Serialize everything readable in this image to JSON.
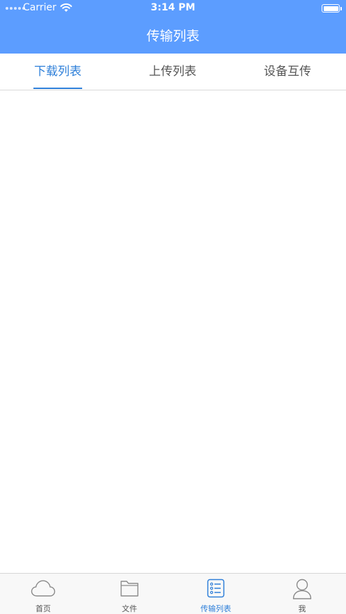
{
  "status_bar": {
    "carrier": "Carrier",
    "time": "3:14 PM"
  },
  "nav": {
    "title": "传输列表"
  },
  "tabs": [
    {
      "label": "下载列表",
      "active": true
    },
    {
      "label": "上传列表",
      "active": false
    },
    {
      "label": "设备互传",
      "active": false
    }
  ],
  "tabbar": [
    {
      "label": "首页",
      "icon": "cloud-icon",
      "active": false
    },
    {
      "label": "文件",
      "icon": "folder-icon",
      "active": false
    },
    {
      "label": "传输列表",
      "icon": "list-icon",
      "active": true
    },
    {
      "label": "我",
      "icon": "user-icon",
      "active": false
    }
  ],
  "colors": {
    "header_bg": "#5c9dff",
    "accent": "#2e7fd9",
    "text_inactive": "#555555",
    "divider": "#d9d9d9"
  }
}
